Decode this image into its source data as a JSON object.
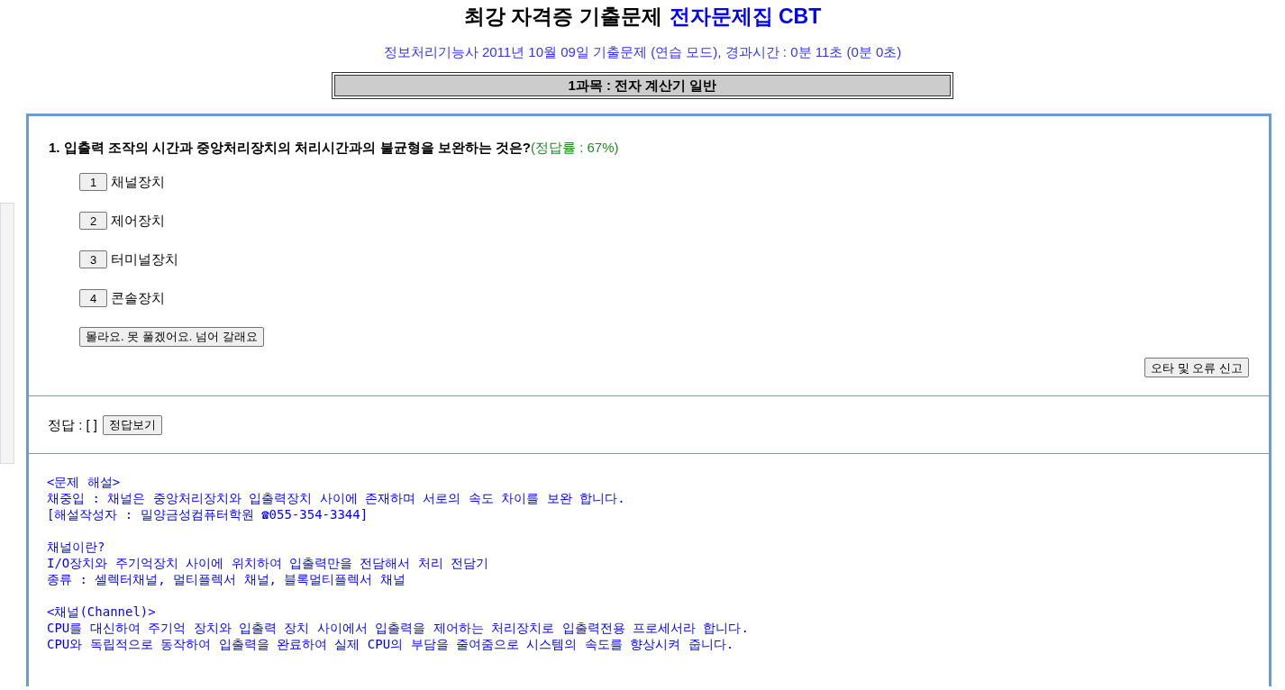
{
  "header": {
    "title": "최강 자격증 기출문제",
    "title_highlight": "전자문제집 CBT",
    "subtitle": "정보처리기능사 2011년 10월 09일 기출문제 (연습 모드), 경과시간 : 0분 11초 (0분 0초)"
  },
  "subject": "1과목 : 전자 계산기 일반",
  "question": {
    "text": "1. 입출력 조작의 시간과 중앙처리장치의 처리시간과의 불균형을 보완하는 것은?",
    "rate": "(정답률 : 67%)",
    "choices": [
      {
        "number": "1",
        "label": "채널장치"
      },
      {
        "number": "2",
        "label": "제어장치"
      },
      {
        "number": "3",
        "label": "터미널장치"
      },
      {
        "number": "4",
        "label": "콘솔장치"
      }
    ],
    "skip_button": "몰라요. 못 풀겠어요. 넘어 갈래요",
    "report_button": "오타 및 오류 신고"
  },
  "answer": {
    "label": "정답 : [ ]",
    "button": "정답보기"
  },
  "explanation": [
    [
      "<문제 해설>",
      "채중입 : 채널은 중앙처리장치와 입출력장치 사이에 존재하며 서로의 속도 차이를 보완 합니다.",
      "[해설작성자 : 밀양금성컴퓨터학원 ☎055-354-3344]"
    ],
    [
      "채널이란?",
      "I/O장치와 주기억장치 사이에 위치하여 입출력만을 전담해서 처리 전담기",
      "종류 : 셀렉터채널, 멀티플렉서 채널, 블록멀티플렉서 채널"
    ],
    [
      "<채널(Channel)>",
      "CPU를 대신하여 주기억 장치와 입출력 장치 사이에서 입출력을 제어하는 처리장치로 입출력전용 프로세서라 합니다.",
      "CPU와 독립적으로 동작하여 입출력을 완료하여 실제 CPU의 부담을 줄여줌으로 시스템의 속도를 향상시켜 줍니다."
    ]
  ]
}
